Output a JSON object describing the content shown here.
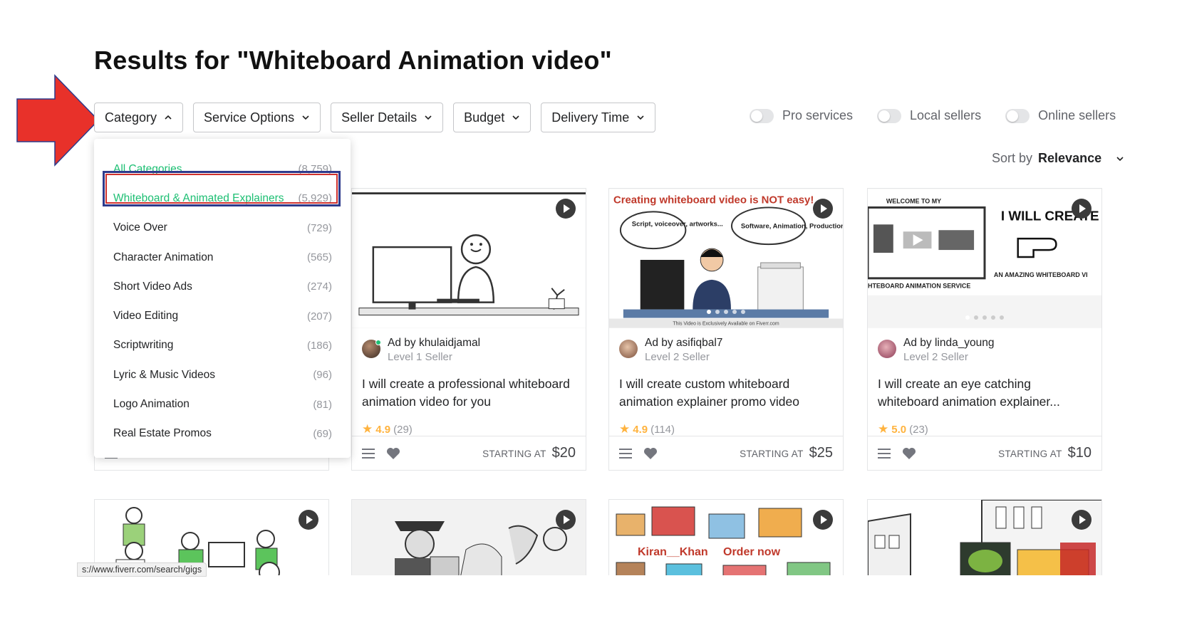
{
  "page": {
    "title": "Results for \"Whiteboard Animation video\""
  },
  "filters": [
    {
      "label": "Category",
      "expanded": true
    },
    {
      "label": "Service Options",
      "expanded": false
    },
    {
      "label": "Seller Details",
      "expanded": false
    },
    {
      "label": "Budget",
      "expanded": false
    },
    {
      "label": "Delivery Time",
      "expanded": false
    }
  ],
  "toggles": [
    {
      "label": "Pro services",
      "on": false
    },
    {
      "label": "Local sellers",
      "on": false
    },
    {
      "label": "Online sellers",
      "on": false
    }
  ],
  "sort": {
    "label": "Sort by",
    "value": "Relevance"
  },
  "category_dropdown": {
    "items": [
      {
        "label": "All Categories",
        "count": "(8,759)"
      },
      {
        "label": "Whiteboard & Animated Explainers",
        "count": "(5,929)"
      },
      {
        "label": "Voice Over",
        "count": "(729)"
      },
      {
        "label": "Character Animation",
        "count": "(565)"
      },
      {
        "label": "Short Video Ads",
        "count": "(274)"
      },
      {
        "label": "Video Editing",
        "count": "(207)"
      },
      {
        "label": "Scriptwriting",
        "count": "(186)"
      },
      {
        "label": "Lyric & Music Videos",
        "count": "(96)"
      },
      {
        "label": "Logo Animation",
        "count": "(81)"
      },
      {
        "label": "Real Estate Promos",
        "count": "(69)"
      }
    ]
  },
  "gigs": [
    {
      "seller": "Ad by khulaidjamal",
      "level": "Level 1 Seller",
      "title": "I will create a professional whiteboard animation video for you",
      "rating": "4.9",
      "reviews": "(29)",
      "price_label": "STARTING AT",
      "price": "$20"
    },
    {
      "seller": "Ad by asifiqbal7",
      "level": "Level 2 Seller",
      "title": "I will create custom whiteboard animation explainer promo video",
      "rating": "4.9",
      "reviews": "(114)",
      "price_label": "STARTING AT",
      "price": "$25",
      "thumb_text": {
        "headline": "Creating whiteboard video is NOT easy!",
        "bubble1": "Script, voiceover, artworks...",
        "bubble2": "Software, Animation, Production...",
        "footer": "This Video is Exclusively Available on Fiverr.com"
      }
    },
    {
      "seller": "Ad by linda_young",
      "level": "Level 2 Seller",
      "title": "I will create an eye catching whiteboard animation explainer...",
      "rating": "5.0",
      "reviews": "(23)",
      "price_label": "STARTING AT",
      "price": "$10",
      "thumb_text": {
        "welcome": "WELCOME TO MY",
        "service": "HTEBOARD ANIMATION SERVICE",
        "headline": "I WILL CREATE",
        "sub": "AN AMAZING WHITEBOARD VI"
      }
    }
  ],
  "row2_thumbs": {
    "third": {
      "left": "Kiran__Khan",
      "right": "Order now"
    }
  },
  "status_bar": {
    "url": "s://www.fiverr.com/search/gigs"
  },
  "colors": {
    "accent_green": "#1dbf73",
    "arrow_red": "#e8312a",
    "star": "#ffb33e"
  }
}
